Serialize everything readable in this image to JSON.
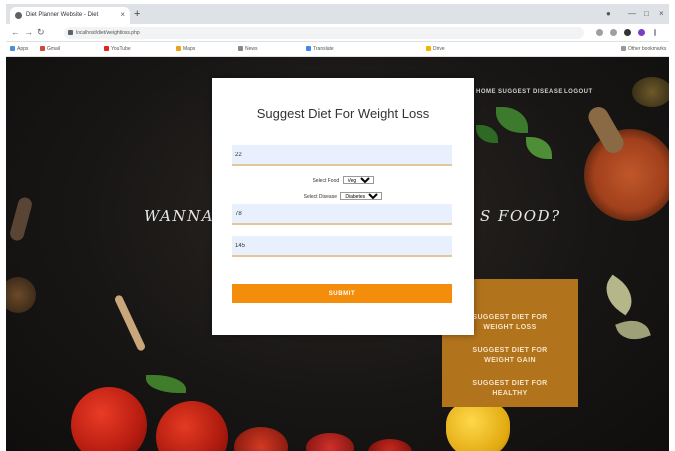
{
  "browser": {
    "tab_title": "Diet Planner Website - Diet",
    "new_tab": "+",
    "minimize": "—",
    "maximize": "□",
    "close": "×",
    "url": "localhost/diet/weightloss.php",
    "bookmarks": [
      "Apps",
      "Gmail",
      "YouTube",
      "Maps",
      "News",
      "Translate",
      "Drive",
      "Other bookmarks"
    ]
  },
  "nav": {
    "items": [
      "HOME",
      "SUGGEST DISEASE",
      "LOGOUT"
    ]
  },
  "hero": {
    "left_text": "WANNA",
    "right_text": "S FOOD?"
  },
  "actions": {
    "items": [
      {
        "line1": "SUGGEST DIET FOR",
        "line2": "WEIGHT LOSS"
      },
      {
        "line1": "SUGGEST DIET FOR",
        "line2": "WEIGHT GAIN"
      },
      {
        "line1": "SUGGEST DIET FOR",
        "line2": "HEALTHY"
      }
    ]
  },
  "modal": {
    "title": "Suggest Diet For Weight Loss",
    "age_value": "22",
    "food_label": "Select Food",
    "food_selected": "Veg",
    "disease_label": "Select Disease",
    "disease_selected": "Diabetes",
    "weight_value": "78",
    "height_value": "145",
    "submit_label": "SUBMIT"
  },
  "colors": {
    "submit": "#f58d0c",
    "action_panel": "#b1731c",
    "input_bg": "#e8f0fe"
  }
}
